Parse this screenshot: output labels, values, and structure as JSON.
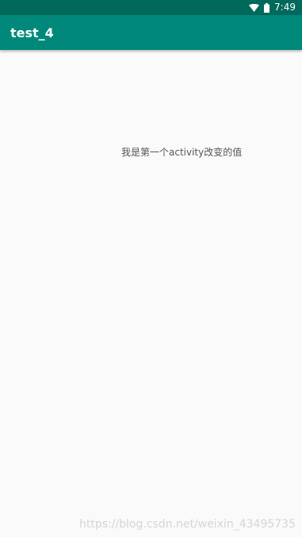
{
  "status_bar": {
    "time": "7:49",
    "icons": [
      "wifi-icon",
      "battery-icon"
    ]
  },
  "app_bar": {
    "title": "test_4"
  },
  "main": {
    "message": "我是第一个activity改变的值"
  },
  "watermark": {
    "text": "https://blog.csdn.net/weixin_43495735"
  },
  "colors": {
    "status_bar": "#00695c",
    "app_bar": "#00897b",
    "background": "#fafafa",
    "text": "#555555"
  }
}
